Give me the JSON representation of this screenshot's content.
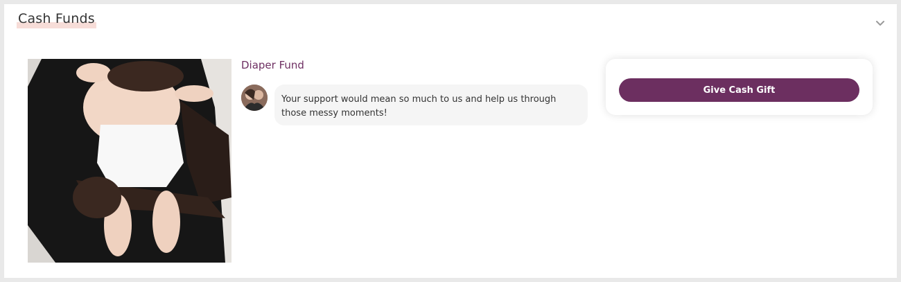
{
  "section": {
    "title": "Cash Funds",
    "toggle_icon": "chevron-down-icon"
  },
  "fund": {
    "title": "Diaper Fund",
    "photo_icon": "baby-photo",
    "avatar_icon": "couple-avatar",
    "message": "Your support would mean so much to us and help us through those messy moments!",
    "cta_label": "Give Cash Gift"
  },
  "colors": {
    "accent": "#6c2f60",
    "title_highlight": "#f7ddd8",
    "bubble_bg": "#f5f5f5"
  }
}
